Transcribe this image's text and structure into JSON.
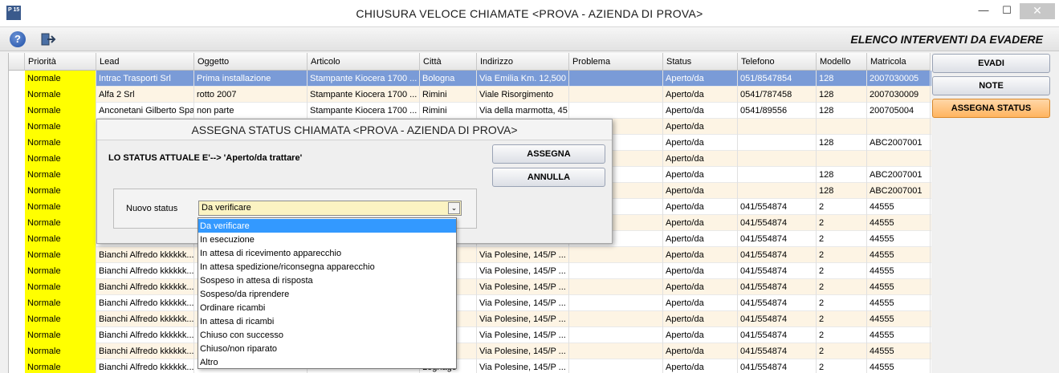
{
  "window": {
    "title": "CHIUSURA VELOCE CHIAMATE <PROVA - AZIENDA DI PROVA>",
    "logo": "P 15",
    "controls": {
      "minimize": "—",
      "maximize": "☐",
      "close": "✕"
    }
  },
  "toolbar": {
    "heading": "ELENCO INTERVENTI DA EVADERE",
    "help_icon": "?",
    "exit_icon": "exit-icon"
  },
  "table": {
    "columns": [
      "Priorità",
      "Lead",
      "Oggetto",
      "Articolo",
      "Città",
      "Indirizzo",
      "Problema",
      "Status",
      "Telefono",
      "Modello",
      "Matricola"
    ],
    "rows": [
      [
        "Normale",
        "Intrac Trasporti Srl",
        "Prima installazione",
        "Stampante Kiocera 1700 ...",
        "Bologna",
        "Via Emilia Km. 12,500",
        "",
        "Aperto/da",
        "051/8547854",
        "128",
        "2007030005"
      ],
      [
        "Normale",
        "Alfa 2 Srl",
        "rotto 2007",
        "Stampante Kiocera 1700 ...",
        "Rimini",
        "Viale Risorgimento",
        "",
        "Aperto/da",
        "0541/787458",
        "128",
        "2007030009"
      ],
      [
        "Normale",
        "Anconetani Gilberto Spa",
        "non parte",
        "Stampante Kiocera 1700 ...",
        "Rimini",
        "Via della marmotta, 45",
        "",
        "Aperto/da",
        "0541/89556",
        "128",
        "200705004"
      ],
      [
        "Normale",
        "",
        "",
        "",
        "",
        "",
        "",
        "Aperto/da",
        "",
        "",
        ""
      ],
      [
        "Normale",
        "",
        "",
        "",
        "",
        "",
        "",
        "Aperto/da",
        "",
        "128",
        "ABC2007001"
      ],
      [
        "Normale",
        "",
        "",
        "",
        "",
        "",
        "",
        "Aperto/da",
        "",
        "",
        ""
      ],
      [
        "Normale",
        "",
        "",
        "",
        "",
        "",
        "",
        "Aperto/da",
        "",
        "128",
        "ABC2007001"
      ],
      [
        "Normale",
        "",
        "",
        "",
        "",
        "",
        "",
        "Aperto/da",
        "",
        "128",
        "ABC2007001"
      ],
      [
        "Normale",
        "",
        "",
        "",
        "",
        "",
        "",
        "Aperto/da",
        "041/554874",
        "2",
        "44555"
      ],
      [
        "Normale",
        "",
        "",
        "",
        "",
        "",
        "",
        "Aperto/da",
        "041/554874",
        "2",
        "44555"
      ],
      [
        "Normale",
        "",
        "",
        "",
        "",
        "",
        "",
        "Aperto/da",
        "041/554874",
        "2",
        "44555"
      ],
      [
        "Normale",
        "Bianchi Alfredo kkkkkk...",
        "",
        "",
        "",
        "Via Polesine, 145/P ...",
        "",
        "Aperto/da",
        "041/554874",
        "2",
        "44555"
      ],
      [
        "Normale",
        "Bianchi Alfredo kkkkkk...",
        "",
        "",
        "",
        "Via Polesine, 145/P ...",
        "",
        "Aperto/da",
        "041/554874",
        "2",
        "44555"
      ],
      [
        "Normale",
        "Bianchi Alfredo kkkkkk...",
        "",
        "",
        "",
        "Via Polesine, 145/P ...",
        "",
        "Aperto/da",
        "041/554874",
        "2",
        "44555"
      ],
      [
        "Normale",
        "Bianchi Alfredo kkkkkk...",
        "",
        "",
        "",
        "Via Polesine, 145/P ...",
        "",
        "Aperto/da",
        "041/554874",
        "2",
        "44555"
      ],
      [
        "Normale",
        "Bianchi Alfredo kkkkkk...",
        "",
        "",
        "",
        "Via Polesine, 145/P ...",
        "",
        "Aperto/da",
        "041/554874",
        "2",
        "44555"
      ],
      [
        "Normale",
        "Bianchi Alfredo kkkkkk...",
        "",
        "",
        "",
        "Via Polesine, 145/P ...",
        "",
        "Aperto/da",
        "041/554874",
        "2",
        "44555"
      ],
      [
        "Normale",
        "Bianchi Alfredo kkkkkk...",
        "",
        "",
        "",
        "Via Polesine, 145/P ...",
        "",
        "Aperto/da",
        "041/554874",
        "2",
        "44555"
      ],
      [
        "Normale",
        "Bianchi Alfredo kkkkkk...",
        "",
        "",
        "Legnago",
        "Via Polesine, 145/P ...",
        "",
        "Aperto/da",
        "041/554874",
        "2",
        "44555"
      ]
    ],
    "selected_row": 0
  },
  "actions": {
    "evadi": "EVADI",
    "note": "NOTE",
    "assegna_status": "ASSEGNA STATUS"
  },
  "dialog": {
    "title": "ASSEGNA STATUS CHIAMATA <PROVA - AZIENDA DI PROVA>",
    "current_status": "LO STATUS ATTUALE E'--> 'Aperto/da trattare'",
    "assegna": "ASSEGNA",
    "annulla": "ANNULLA",
    "field_label": "Nuovo status",
    "selected": "Da verificare",
    "chevron": "⌄",
    "options": [
      "Da verificare",
      "In esecuzione",
      "In attesa di ricevimento apparecchio",
      "In attesa spedizione/riconsegna apparecchio",
      "Sospeso in attesa di risposta",
      "Sospeso/da riprendere",
      "Ordinare ricambi",
      "In attesa di ricambi",
      "Chiuso con successo",
      "Chiuso/non riparato",
      "Altro"
    ]
  },
  "side_icons": [
    "list-icon",
    "document-icon",
    "export-icon",
    "zoom-icon",
    "grid-icon",
    "filter-icon",
    "filter-clear-icon",
    "anchor-icon",
    "export-x-icon",
    "export-h-icon",
    "export-c-icon",
    "monitor-icon",
    "printer-icon"
  ]
}
